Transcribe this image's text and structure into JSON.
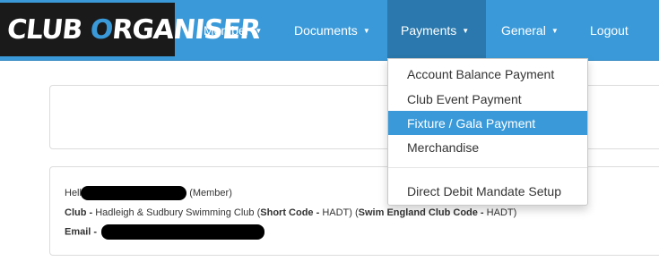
{
  "brand": {
    "logo_text_prefix": "CLUB ",
    "logo_accent": "O",
    "logo_text_suffix": "RGANISER"
  },
  "nav": {
    "member": "Member",
    "documents": "Documents",
    "payments": "Payments",
    "general": "General",
    "logout": "Logout"
  },
  "payments_menu": {
    "items": [
      "Account Balance Payment",
      "Club Event Payment",
      "Fixture / Gala Payment",
      "Merchandise",
      "Direct Debit Mandate Setup"
    ],
    "highlighted_item": "Fixture / Gala Payment"
  },
  "member_info": {
    "hello_prefix": "Hello",
    "role": "(Member)",
    "club_label": "Club -",
    "club_name": "Hadleigh & Sudbury Swimming Club (",
    "short_code_label": "Short Code -",
    "short_code": "HADT) (",
    "se_code_label": "Swim England Club Code -",
    "se_code": "HADT)",
    "email_label": "Email -"
  },
  "colors": {
    "accent": "#3a9ad9",
    "active_nav": "#2a78ad",
    "brand_bg": "#1a1a1a"
  },
  "icons": {
    "dropdown_caret": "caret-down-icon"
  }
}
